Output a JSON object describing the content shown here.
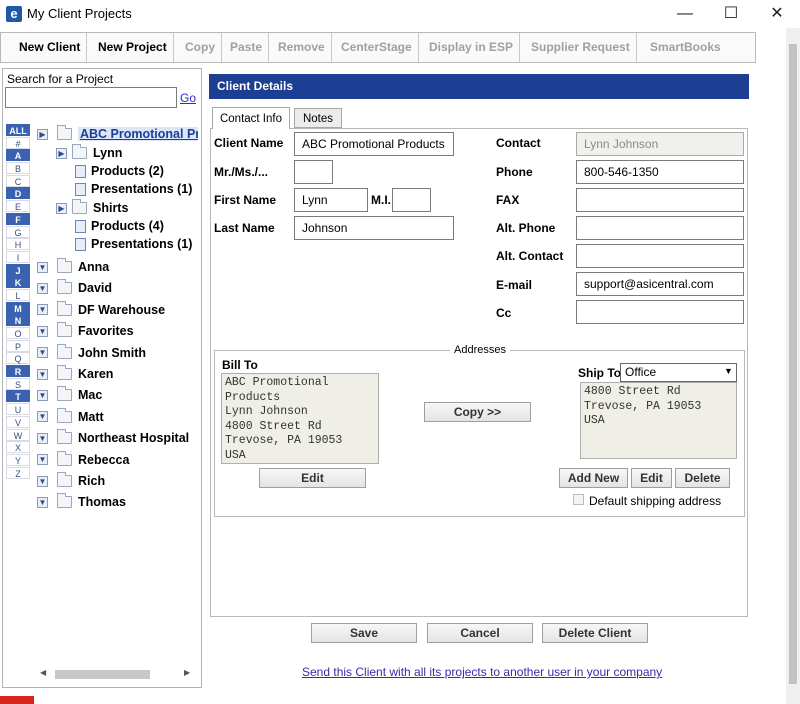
{
  "window": {
    "title": "My Client Projects",
    "minimize": "—",
    "maximize": "☐",
    "close": "✕"
  },
  "toolbar": {
    "new_client": "New Client",
    "new_project": "New Project",
    "copy": "Copy",
    "paste": "Paste",
    "remove": "Remove",
    "centerstage": "CenterStage",
    "display_esp": "Display in ESP",
    "supplier_request": "Supplier Request",
    "smartbooks": "SmartBooks"
  },
  "search": {
    "label": "Search for a Project",
    "go": "Go",
    "value": ""
  },
  "letters": [
    "ALL",
    "#",
    "A",
    "B",
    "C",
    "D",
    "E",
    "F",
    "G",
    "H",
    "I",
    "J",
    "K",
    "L",
    "M",
    "N",
    "O",
    "P",
    "Q",
    "R",
    "S",
    "T",
    "U",
    "V",
    "W",
    "X",
    "Y",
    "Z"
  ],
  "tree": {
    "expanded_client": "ABC Promotional Products",
    "lynn": "Lynn",
    "lynn_products": "Products (2)",
    "lynn_presentations": "Presentations (1)",
    "shirts": "Shirts",
    "shirts_products": "Products (4)",
    "shirts_presentations": "Presentations (1)",
    "clients": [
      "Anna",
      "David",
      "DF Warehouse",
      "Favorites",
      "John Smith",
      "Karen",
      "Mac",
      "Matt",
      "Northeast Hospital",
      "Rebecca",
      "Rich",
      "Thomas"
    ]
  },
  "details": {
    "header": "Client Details",
    "tab_contact": "Contact Info",
    "tab_notes": "Notes",
    "labels": {
      "client_name": "Client Name",
      "mr_ms": "Mr./Ms./...",
      "first_name": "First Name",
      "mi": "M.I.",
      "last_name": "Last Name",
      "contact": "Contact",
      "phone": "Phone",
      "fax": "FAX",
      "alt_phone": "Alt. Phone",
      "alt_contact": "Alt. Contact",
      "email": "E-mail",
      "cc": "Cc"
    },
    "values": {
      "client_name": "ABC Promotional Products",
      "mr_ms": "",
      "first_name": "Lynn",
      "mi": "",
      "last_name": "Johnson",
      "contact": "Lynn Johnson",
      "phone": "800-546-1350",
      "fax": "",
      "alt_phone": "",
      "alt_contact": "",
      "email": "support@asicentral.com",
      "cc": ""
    }
  },
  "addresses": {
    "legend": "Addresses",
    "bill_to_label": "Bill To",
    "bill_to": "ABC Promotional\nProducts\nLynn Johnson\n4800 Street Rd\nTrevose, PA 19053\nUSA",
    "edit": "Edit",
    "copy": "Copy >>",
    "ship_to_label": "Ship To",
    "ship_to_selected": "Office",
    "ship_to": "4800 Street Rd\nTrevose, PA 19053\nUSA",
    "add_new": "Add New",
    "ship_edit": "Edit",
    "delete": "Delete",
    "default_shipping": "Default shipping address"
  },
  "footer": {
    "save": "Save",
    "cancel": "Cancel",
    "delete_client": "Delete Client",
    "send_link": "Send this Client with all its projects to another user in your company"
  }
}
